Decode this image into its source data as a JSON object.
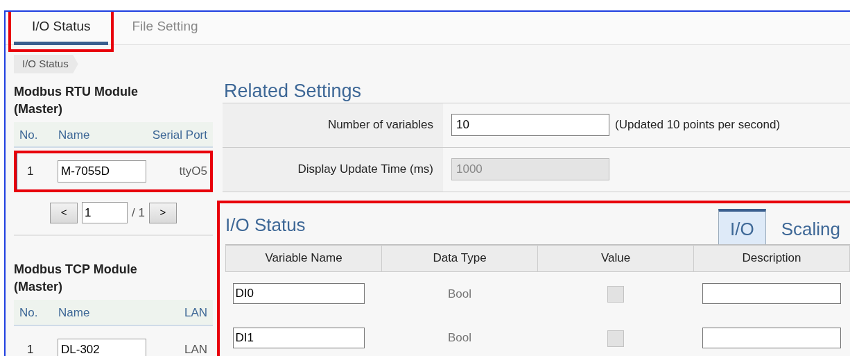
{
  "tabs": [
    {
      "label": "I/O Status",
      "selected": true,
      "highlighted": true
    },
    {
      "label": "File Setting",
      "selected": false,
      "highlighted": false
    }
  ],
  "breadcrumb": "I/O Status",
  "modules": [
    {
      "title": "Modbus RTU Module\n(Master)",
      "columns": [
        "No.",
        "Name",
        "Serial Port"
      ],
      "rows": [
        {
          "no": "1",
          "name": "M-7055D",
          "port": "ttyO5",
          "selected": true,
          "highlighted": true
        }
      ],
      "pager": {
        "prev": "<",
        "page": "1",
        "total": "/ 1",
        "next": ">"
      }
    },
    {
      "title": "Modbus TCP Module\n(Master)",
      "columns": [
        "No.",
        "Name",
        "LAN"
      ],
      "rows": [
        {
          "no": "1",
          "name": "DL-302",
          "port": "LAN",
          "selected": false,
          "highlighted": false
        }
      ]
    }
  ],
  "related_settings": {
    "title": "Related Settings",
    "fields": [
      {
        "label": "Number of variables",
        "value": "10",
        "disabled": false,
        "note": "(Updated 10 points per second)"
      },
      {
        "label": "Display Update Time (ms)",
        "value": "1000",
        "disabled": true
      }
    ]
  },
  "io_panel": {
    "title": "I/O Status",
    "highlighted": true,
    "tabs": [
      {
        "label": "I/O",
        "selected": true
      },
      {
        "label": "Scaling",
        "selected": false
      }
    ],
    "columns": [
      "Variable Name",
      "Data Type",
      "Value",
      "Description"
    ],
    "rows": [
      {
        "name": "DI0",
        "type": "Bool",
        "checked": false,
        "disabled": true
      },
      {
        "name": "DI1",
        "type": "Bool",
        "checked": false,
        "disabled": true
      }
    ]
  }
}
